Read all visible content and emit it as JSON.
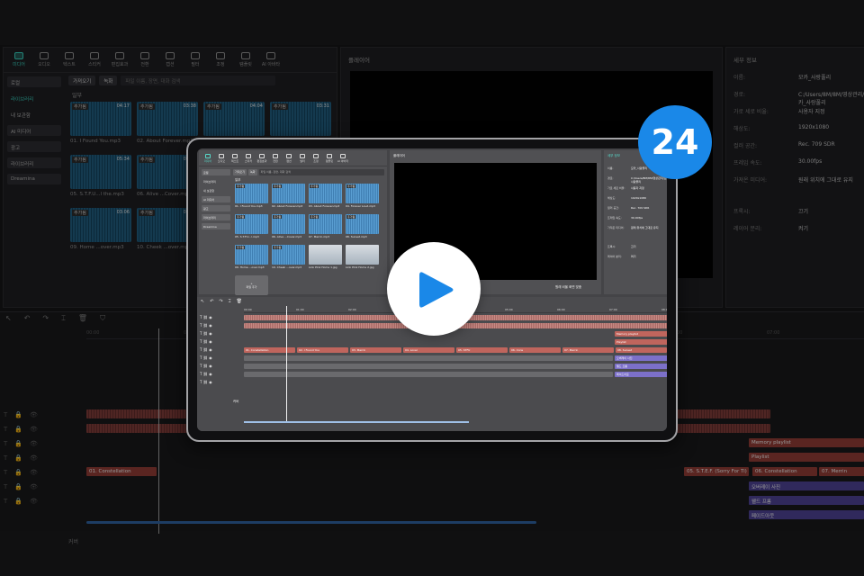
{
  "colors": {
    "accent": "#35c7b6",
    "badge_blue": "#1a88e8",
    "clip_red": "#8a3a33",
    "clip_purple": "#4a3f8e"
  },
  "toolbar": [
    {
      "label": "미디어",
      "icon": "media-icon",
      "active": true
    },
    {
      "label": "오디오",
      "icon": "audio-icon"
    },
    {
      "label": "텍스트",
      "icon": "text-icon"
    },
    {
      "label": "스티커",
      "icon": "sticker-icon"
    },
    {
      "label": "편집효과",
      "icon": "effects-icon"
    },
    {
      "label": "전환",
      "icon": "transition-icon"
    },
    {
      "label": "캡션",
      "icon": "caption-icon"
    },
    {
      "label": "필터",
      "icon": "filter-icon"
    },
    {
      "label": "조정",
      "icon": "adjust-icon"
    },
    {
      "label": "템플릿",
      "icon": "template-icon"
    },
    {
      "label": "AI 아바타",
      "icon": "ai-avatar-icon"
    }
  ],
  "media": {
    "sidebar": [
      "로컬",
      "라이브러리",
      "내 보관함",
      "AI 미디어",
      "광고",
      "라이브러리",
      "Dreamina"
    ],
    "sidebar_selected": "라이브러리",
    "import_label": "가져오기",
    "record_label": "녹화",
    "search_placeholder": "파일 이름, 장면, 대화 검색",
    "grid_label": "일부",
    "badge": "추가됨",
    "import_tile": "파일 추가",
    "clips": [
      {
        "name": "01. I Found You.mp3",
        "dur": "04:17"
      },
      {
        "name": "02. About Forever.mp3",
        "dur": "03:38"
      },
      {
        "name": "03. Sirens of the.mp3",
        "dur": "04:04"
      },
      {
        "name": "04. Lover.mp3",
        "dur": "03:31"
      },
      {
        "name": "05. S.T.F.U...l the.mp3",
        "dur": "05:34"
      },
      {
        "name": "06. Alive ...Cover.mp3",
        "dur": "03:44"
      },
      {
        "name": "07. Merrin.mp3",
        "dur": "03:50"
      },
      {
        "name": "08. Sunset.mp3",
        "dur": "04:12"
      },
      {
        "name": "09. Home ...over.mp3",
        "dur": "03:06"
      },
      {
        "name": "10. Cheek ...over.mp3",
        "dur": "03:21"
      }
    ],
    "mini_clips": [
      {
        "name": "01. I Found You.mp3"
      },
      {
        "name": "02. About Forever.mp3"
      },
      {
        "name": "03. About Forever.mp3"
      },
      {
        "name": "04. Forever Loud.mp3"
      },
      {
        "name": "05. S.T.F.U...l.mp3"
      },
      {
        "name": "06. Alive ...Cover.mp3"
      },
      {
        "name": "07. Merrin.mp3"
      },
      {
        "name": "08. Sunset.mp3"
      },
      {
        "name": "09. Home ...over.mp3"
      },
      {
        "name": "10. Cheek ...over.mp3"
      },
      {
        "name": "Link Pink Home 1.jpg"
      },
      {
        "name": "Link Pink Home 2.jpg"
      }
    ]
  },
  "player": {
    "title": "플레이어",
    "ctrl_fit": "원래 비율",
    "ctrl_zoom": "화면 맞춤"
  },
  "props": {
    "title": "세부 정보",
    "rows": [
      {
        "k": "이름:",
        "v": "모카_사랑풀리"
      },
      {
        "k": "경로:",
        "v": "C:/Users/8M/8M/영상관리/모카_사랑풀리"
      },
      {
        "k": "가로 세로 비율:",
        "v": "사용자 지정"
      },
      {
        "k": "해상도:",
        "v": "1920x1080"
      },
      {
        "k": "컬러 공간:",
        "v": "Rec. 709 SDR"
      },
      {
        "k": "프레임 속도:",
        "v": "30.00fps"
      },
      {
        "k": "가져온 미디어:",
        "v": "원래 위치에 그대로 유지"
      },
      {
        "k": "프록시:",
        "v": "끄기"
      },
      {
        "k": "레이어 분리:",
        "v": "켜기"
      }
    ]
  },
  "timeline": {
    "ruler": [
      "00:00",
      "01:00",
      "02:00",
      "03:00",
      "04:00",
      "05:00",
      "06:00",
      "07:00",
      "08:00"
    ],
    "audio_segments": [
      "01. Constellation",
      "02. I Found You",
      "03. Merrin",
      "04. About Forever",
      "05. S.T.E.F. (Sorry For Ti)",
      "06. Constellation",
      "07. Merrin"
    ],
    "text_segments": [
      "Memory playlist",
      "Playlist"
    ],
    "purple_segments": [
      "오버레이 사진",
      "웰드 프롬",
      "페이드아웃"
    ],
    "mini_audio": [
      "01. Constellation",
      "02. I Found You",
      "03. Merrin",
      "04. Lover",
      "05. STFU",
      "06. Cons",
      "07. Merrin",
      "08. Sunset"
    ],
    "mini_text": [
      "Memory playlist",
      "Playlist"
    ],
    "mini_purple": [
      "오버레이 사진",
      "웰드 프롬",
      "페이드아웃"
    ],
    "cover_label": "커버"
  },
  "overlay": {
    "count": "24"
  }
}
